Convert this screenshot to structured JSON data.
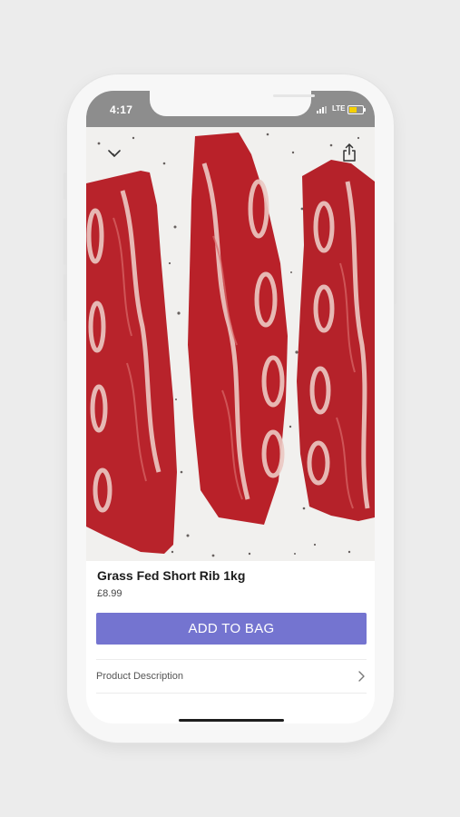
{
  "status_bar": {
    "time": "4:17",
    "network": "LTE",
    "background_color": "#8d8d8d",
    "battery_color": "#f5d000"
  },
  "product": {
    "image_alt": "Three raw grass fed beef short ribs on a white surface with cracked pepper",
    "name": "Grass Fed Short Rib 1kg",
    "price": "£8.99"
  },
  "actions": {
    "add_to_bag_label": "ADD TO BAG",
    "button_color": "#7474d0"
  },
  "sections": {
    "product_description_label": "Product Description"
  },
  "icons": {
    "back": "chevron-down-icon",
    "share": "share-icon",
    "row_arrow": "chevron-right-icon"
  }
}
